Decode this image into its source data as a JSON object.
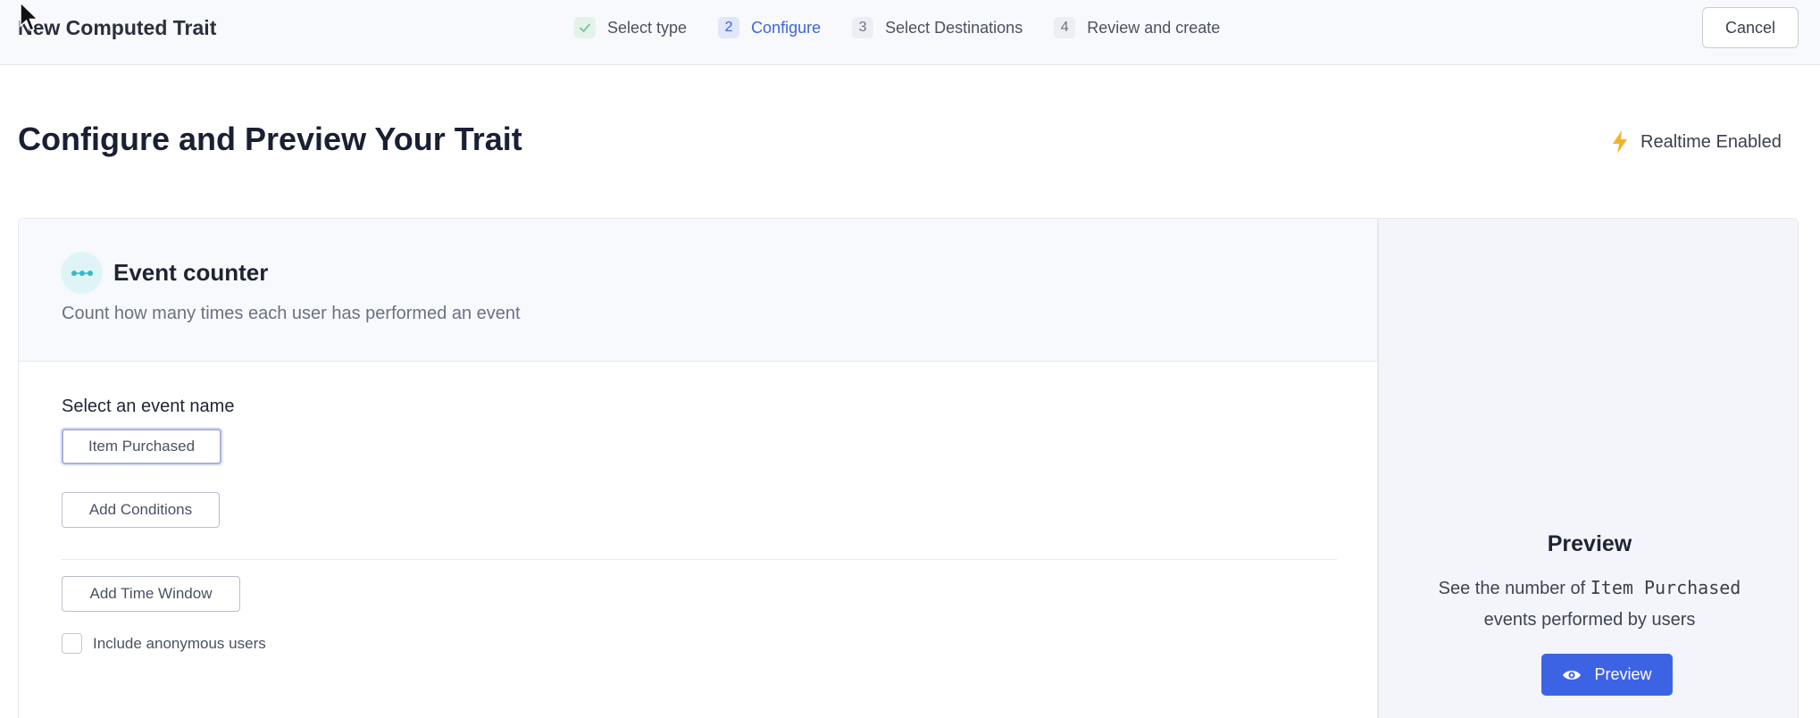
{
  "header": {
    "title": "New Computed Trait",
    "cancel_label": "Cancel",
    "steps": [
      {
        "number": "✓",
        "label": "Select type",
        "state": "done"
      },
      {
        "number": "2",
        "label": "Configure",
        "state": "active"
      },
      {
        "number": "3",
        "label": "Select Destinations",
        "state": "pending"
      },
      {
        "number": "4",
        "label": "Review and create",
        "state": "pending"
      }
    ]
  },
  "page": {
    "title": "Configure and Preview Your Trait",
    "realtime_label": "Realtime Enabled",
    "realtime_icon": "lightning-bolt-icon"
  },
  "trait_type": {
    "icon": "event-counter-icon",
    "title": "Event counter",
    "description": "Count how many times each user has performed an event"
  },
  "form": {
    "event_label": "Select an event name",
    "event_value": "Item Purchased",
    "add_conditions_label": "Add Conditions",
    "add_time_window_label": "Add Time Window",
    "include_anonymous_label": "Include anonymous users",
    "include_anonymous_checked": false
  },
  "preview": {
    "title": "Preview",
    "desc_prefix": "See the number of ",
    "desc_event": "Item Purchased",
    "desc_suffix": "events performed by users",
    "button_label": "Preview"
  },
  "colors": {
    "accent": "#3d63e5",
    "active_step": "#3d66db",
    "realtime_bolt": "#f0b429",
    "event_icon": "#37b8c8"
  }
}
